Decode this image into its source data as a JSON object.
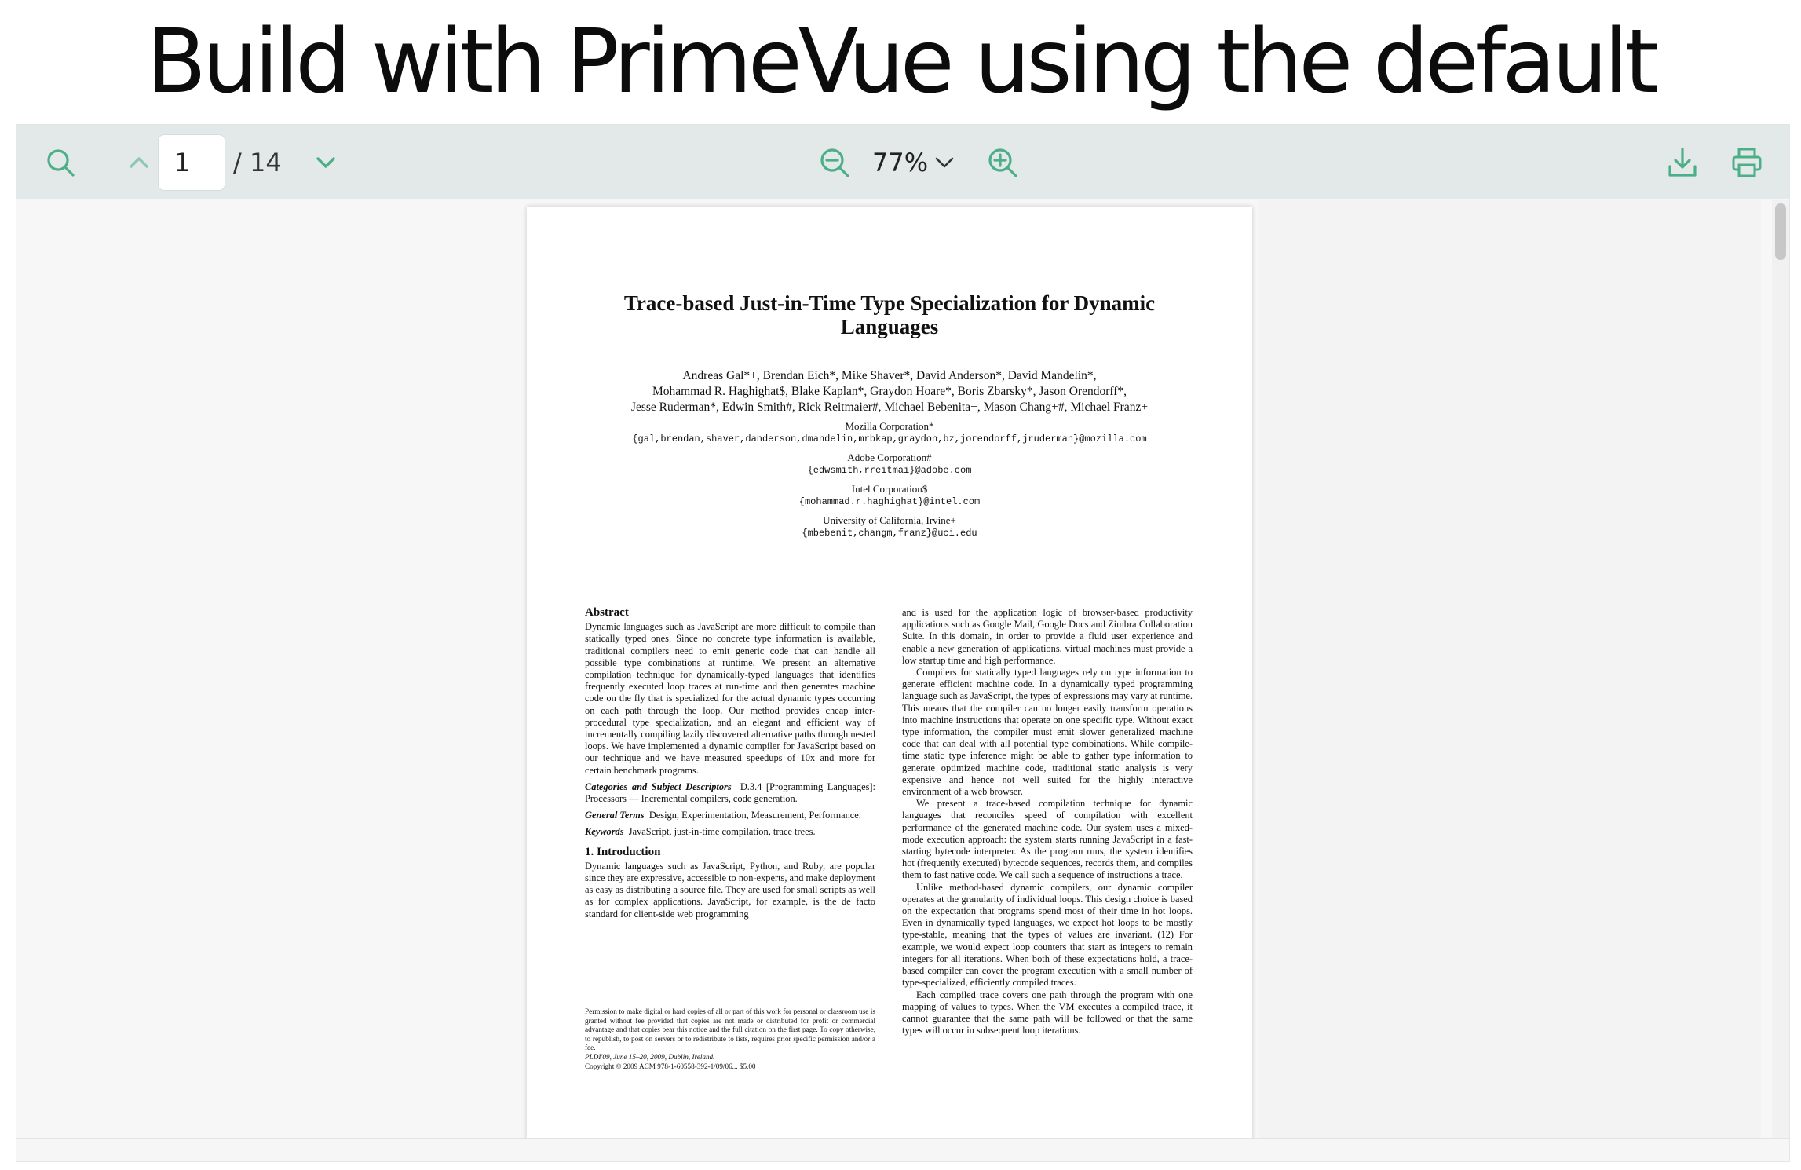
{
  "headline": "Build with PrimeVue using the default toolbar",
  "toolbar": {
    "search_icon": "search-icon",
    "page_number": "1",
    "page_total": "/ 14",
    "zoom_level": "77%",
    "accent_color": "#4caf87"
  },
  "paper": {
    "title_line1": "Trace-based Just-in-Time Type Specialization for Dynamic",
    "title_line2": "Languages",
    "authors_line1": "Andreas Gal*+, Brendan Eich*, Mike Shaver*, David Anderson*, David Mandelin*,",
    "authors_line2": "Mohammad R. Haghighat$, Blake Kaplan*, Graydon Hoare*, Boris Zbarsky*, Jason Orendorff*,",
    "authors_line3": "Jesse Ruderman*, Edwin Smith#, Rick Reitmaier#, Michael Bebenita+, Mason Chang+#, Michael Franz+",
    "affiliations": [
      {
        "name": "Mozilla Corporation*",
        "email": "{gal,brendan,shaver,danderson,dmandelin,mrbkap,graydon,bz,jorendorff,jruderman}@mozilla.com"
      },
      {
        "name": "Adobe Corporation#",
        "email": "{edwsmith,rreitmai}@adobe.com"
      },
      {
        "name": "Intel Corporation$",
        "email": "{mohammad.r.haghighat}@intel.com"
      },
      {
        "name": "University of California, Irvine+",
        "email": "{mbebenit,changm,franz}@uci.edu"
      }
    ],
    "abstract_heading": "Abstract",
    "abstract_text": "Dynamic languages such as JavaScript are more difficult to compile than statically typed ones. Since no concrete type information is available, traditional compilers need to emit generic code that can handle all possible type combinations at runtime. We present an alternative compilation technique for dynamically-typed languages that identifies frequently executed loop traces at run-time and then generates machine code on the fly that is specialized for the actual dynamic types occurring on each path through the loop. Our method provides cheap inter-procedural type specialization, and an elegant and efficient way of incrementally compiling lazily discovered alternative paths through nested loops. We have implemented a dynamic compiler for JavaScript based on our technique and we have measured speedups of 10x and more for certain benchmark programs.",
    "categories_label": "Categories and Subject Descriptors",
    "categories_text": "D.3.4 [Programming Languages]: Processors — Incremental compilers, code generation.",
    "terms_label": "General Terms",
    "terms_text": "Design, Experimentation, Measurement, Performance.",
    "keywords_label": "Keywords",
    "keywords_text": "JavaScript, just-in-time compilation, trace trees.",
    "intro_heading": "1.   Introduction",
    "intro_text": "Dynamic languages such as JavaScript, Python, and Ruby, are popular since they are expressive, accessible to non-experts, and make deployment as easy as distributing a source file. They are used for small scripts as well as for complex applications. JavaScript, for example, is the de facto standard for client-side web programming",
    "right_p1": "and is used for the application logic of browser-based productivity applications such as Google Mail, Google Docs and Zimbra Collaboration Suite. In this domain, in order to provide a fluid user experience and enable a new generation of applications, virtual machines must provide a low startup time and high performance.",
    "right_p2": "Compilers for statically typed languages rely on type information to generate efficient machine code. In a dynamically typed programming language such as JavaScript, the types of expressions may vary at runtime. This means that the compiler can no longer easily transform operations into machine instructions that operate on one specific type. Without exact type information, the compiler must emit slower generalized machine code that can deal with all potential type combinations. While compile-time static type inference might be able to gather type information to generate optimized machine code, traditional static analysis is very expensive and hence not well suited for the highly interactive environment of a web browser.",
    "right_p3": "We present a trace-based compilation technique for dynamic languages that reconciles speed of compilation with excellent performance of the generated machine code. Our system uses a mixed-mode execution approach: the system starts running JavaScript in a fast-starting bytecode interpreter. As the program runs, the system identifies hot (frequently executed) bytecode sequences, records them, and compiles them to fast native code. We call such a sequence of instructions a trace.",
    "right_p4": "Unlike method-based dynamic compilers, our dynamic compiler operates at the granularity of individual loops. This design choice is based on the expectation that programs spend most of their time in hot loops. Even in dynamically typed languages, we expect hot loops to be mostly type-stable, meaning that the types of values are invariant. (12) For example, we would expect loop counters that start as integers to remain integers for all iterations. When both of these expectations hold, a trace-based compiler can cover the program execution with a small number of type-specialized, efficiently compiled traces.",
    "right_p5": "Each compiled trace covers one path through the program with one mapping of values to types. When the VM executes a compiled trace, it cannot guarantee that the same path will be followed or that the same types will occur in subsequent loop iterations.",
    "footnote_text": "Permission to make digital or hard copies of all or part of this work for personal or classroom use is granted without fee provided that copies are not made or distributed for profit or commercial advantage and that copies bear this notice and the full citation on the first page. To copy otherwise, to republish, to post on servers or to redistribute to lists, requires prior specific permission and/or a fee.",
    "footnote_conf": "PLDI'09,   June 15–20, 2009, Dublin, Ireland.",
    "footnote_copy": "Copyright © 2009 ACM 978-1-60558-392-1/09/06... $5.00"
  }
}
